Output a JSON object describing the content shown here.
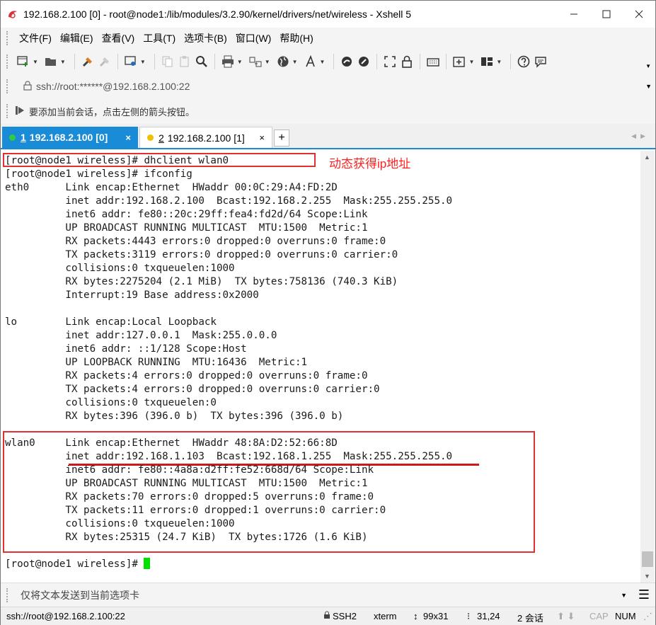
{
  "window": {
    "title": "192.168.2.100 [0] - root@node1:/lib/modules/3.2.90/kernel/drivers/net/wireless - Xshell 5"
  },
  "menu": [
    "文件(F)",
    "编辑(E)",
    "查看(V)",
    "工具(T)",
    "选项卡(B)",
    "窗口(W)",
    "帮助(H)"
  ],
  "address": {
    "value": "ssh://root:******@192.168.2.100:22"
  },
  "hint": {
    "text": "要添加当前会话，点击左侧的箭头按钮。"
  },
  "tabs": [
    {
      "num": "1",
      "label": "192.168.2.100 [0]",
      "close": "×",
      "dot_color": "#2ecc40"
    },
    {
      "num": "2",
      "label": "192.168.2.100 [1]",
      "close": "×",
      "dot_color": "#f0c000"
    }
  ],
  "terminal": {
    "lines": [
      "[root@node1 wireless]# dhclient wlan0",
      "[root@node1 wireless]# ifconfig",
      "eth0      Link encap:Ethernet  HWaddr 00:0C:29:A4:FD:2D",
      "          inet addr:192.168.2.100  Bcast:192.168.2.255  Mask:255.255.255.0",
      "          inet6 addr: fe80::20c:29ff:fea4:fd2d/64 Scope:Link",
      "          UP BROADCAST RUNNING MULTICAST  MTU:1500  Metric:1",
      "          RX packets:4443 errors:0 dropped:0 overruns:0 frame:0",
      "          TX packets:3119 errors:0 dropped:0 overruns:0 carrier:0",
      "          collisions:0 txqueuelen:1000",
      "          RX bytes:2275204 (2.1 MiB)  TX bytes:758136 (740.3 KiB)",
      "          Interrupt:19 Base address:0x2000",
      "",
      "lo        Link encap:Local Loopback",
      "          inet addr:127.0.0.1  Mask:255.0.0.0",
      "          inet6 addr: ::1/128 Scope:Host",
      "          UP LOOPBACK RUNNING  MTU:16436  Metric:1",
      "          RX packets:4 errors:0 dropped:0 overruns:0 frame:0",
      "          TX packets:4 errors:0 dropped:0 overruns:0 carrier:0",
      "          collisions:0 txqueuelen:0",
      "          RX bytes:396 (396.0 b)  TX bytes:396 (396.0 b)",
      "",
      "wlan0     Link encap:Ethernet  HWaddr 48:8A:D2:52:66:8D",
      "          inet addr:192.168.1.103  Bcast:192.168.1.255  Mask:255.255.255.0",
      "          inet6 addr: fe80::4a8a:d2ff:fe52:668d/64 Scope:Link",
      "          UP BROADCAST RUNNING MULTICAST  MTU:1500  Metric:1",
      "          RX packets:70 errors:0 dropped:5 overruns:0 frame:0",
      "          TX packets:11 errors:0 dropped:1 overruns:0 carrier:0",
      "          collisions:0 txqueuelen:1000",
      "          RX bytes:25315 (24.7 KiB)  TX bytes:1726 (1.6 KiB)",
      "",
      "[root@node1 wireless]# "
    ],
    "annotation": "动态获得ip地址",
    "cursor_color": "#00e000",
    "highlight_color": "#e03030"
  },
  "compose": {
    "placeholder": "仅将文本发送到当前选项卡"
  },
  "status": {
    "connection": "ssh://root@192.168.2.100:22",
    "protocol": "SSH2",
    "terminal": "xterm",
    "size": "99x31",
    "cursor": "31,24",
    "sessions": "2 会话",
    "caps": "CAP",
    "num": "NUM"
  },
  "colors": {
    "accent": "#1a8bd6"
  }
}
